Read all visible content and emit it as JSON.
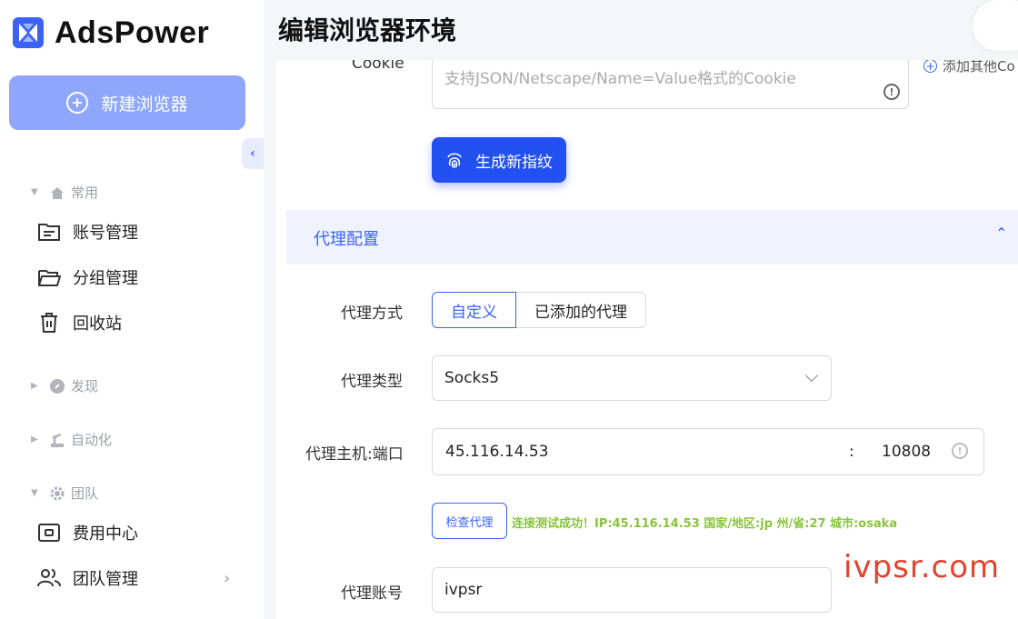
{
  "brand": {
    "name": "AdsPower",
    "accent": "#3a63f5"
  },
  "sidebar": {
    "new_browser_label": "新建浏览器",
    "sections": [
      {
        "label": "常用",
        "icon": "home-icon",
        "expanded": true
      },
      {
        "label": "发现",
        "icon": "compass-icon",
        "expanded": false
      },
      {
        "label": "自动化",
        "icon": "robot-arm-icon",
        "expanded": false
      },
      {
        "label": "团队",
        "icon": "gear-icon",
        "expanded": true
      }
    ],
    "items": [
      {
        "label": "账号管理",
        "icon": "account-folder-icon"
      },
      {
        "label": "分组管理",
        "icon": "open-folder-icon"
      },
      {
        "label": "回收站",
        "icon": "trash-icon"
      },
      {
        "label": "费用中心",
        "icon": "wallet-icon"
      },
      {
        "label": "团队管理",
        "icon": "users-icon"
      }
    ]
  },
  "header": {
    "title": "编辑浏览器环境"
  },
  "cookie": {
    "label": "Cookie",
    "placeholder": "支持JSON/Netscape/Name=Value格式的Cookie",
    "add_other": "添加其他Co"
  },
  "generate_button": "生成新指纹",
  "proxy": {
    "section_title": "代理配置",
    "method_label": "代理方式",
    "method_options": [
      "自定义",
      "已添加的代理"
    ],
    "method_selected": "自定义",
    "type_label": "代理类型",
    "type_value": "Socks5",
    "hostport_label": "代理主机:端口",
    "host": "45.116.14.53",
    "separator": ":",
    "port": "10808",
    "check_button": "检查代理",
    "check_result": "连接测试成功！IP:45.116.14.53 国家/地区:jp 州/省:27 城市:osaka",
    "check_result_color": "#88c53a",
    "account_label": "代理账号",
    "account_value": "ivpsr"
  },
  "watermark": "ivpsr.com"
}
